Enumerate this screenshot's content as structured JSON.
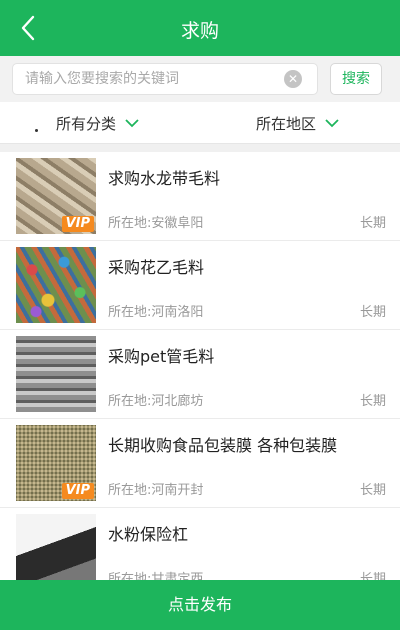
{
  "header": {
    "title": "求购"
  },
  "search": {
    "placeholder": "请输入您要搜索的关键词",
    "button_label": "搜索"
  },
  "filters": {
    "category_label": "所有分类",
    "region_label": "所在地区"
  },
  "listings": [
    {
      "name": "求购水龙带毛料",
      "location": "所在地:安徽阜阳",
      "term": "长期",
      "vip": "VIP"
    },
    {
      "name": "采购花乙毛料",
      "location": "所在地:河南洛阳",
      "term": "长期"
    },
    {
      "name": "采购pet管毛料",
      "location": "所在地:河北廊坊",
      "term": "长期"
    },
    {
      "name": "长期收购食品包装膜 各种包装膜",
      "location": "所在地:河南开封",
      "term": "长期",
      "vip": "VIP"
    },
    {
      "name": "水粉保险杠",
      "location": "所在地:甘肃定西",
      "term": "长期"
    }
  ],
  "footer": {
    "publish_label": "点击发布"
  },
  "colors": {
    "brand_green": "#1db55c",
    "vip_orange": "#f58a1f"
  },
  "icons": [
    "back-arrow-icon",
    "clear-icon",
    "chevron-down-icon"
  ]
}
